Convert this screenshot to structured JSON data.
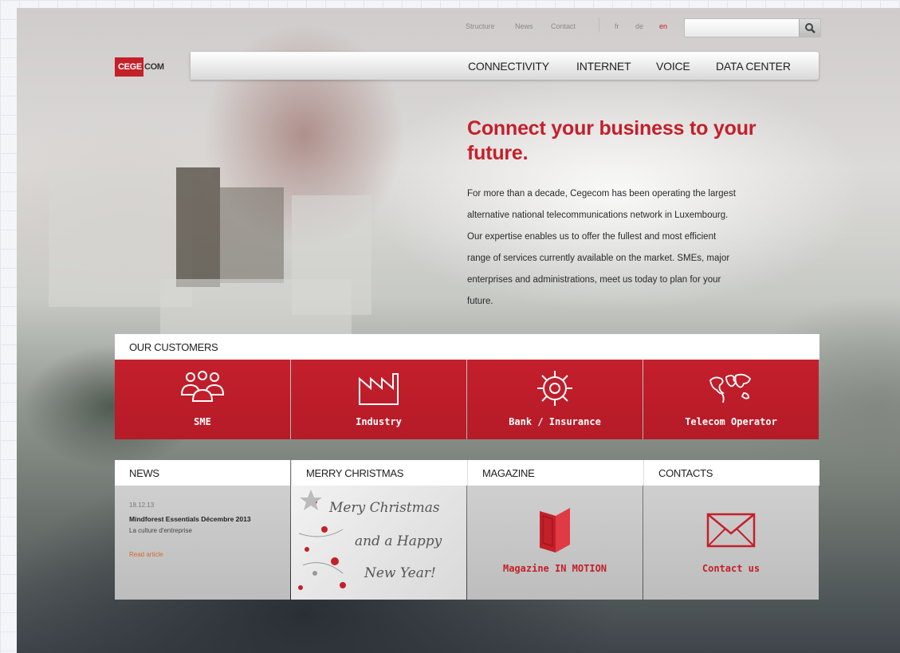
{
  "topbar": {
    "links": [
      "Structure",
      "News",
      "Contact"
    ],
    "languages": [
      "fr",
      "de",
      "en"
    ],
    "search_placeholder": ""
  },
  "logo": {
    "part1": "CEGE",
    "part2": "COM"
  },
  "nav": {
    "items": [
      "CONNECTIVITY",
      "INTERNET",
      "VOICE",
      "DATA CENTER"
    ]
  },
  "hero": {
    "title_line1": "Connect your business to your",
    "title_line2": "future.",
    "lines": [
      "For more than a decade, Cegecom has been operating the largest",
      "alternative national telecommunications network in Luxembourg.",
      "Our expertise enables us to offer the fullest and most efficient",
      "range of services currently available on the market. SMEs, major",
      "enterprises and administrations, meet us today to plan for your",
      "future."
    ]
  },
  "customers": {
    "header": "OUR CUSTOMERS",
    "tiles": [
      {
        "label": "SME",
        "icon": "people-icon"
      },
      {
        "label": "Industry",
        "icon": "factory-icon"
      },
      {
        "label": "Bank / Insurance",
        "icon": "helm-icon"
      },
      {
        "label": "Telecom Operator",
        "icon": "world-map-icon"
      }
    ]
  },
  "panels": {
    "news": {
      "header": "NEWS",
      "date": "18.12.13",
      "title": "Mindforest Essentials Décembre 2013",
      "subtitle": "La culture d'entreprise",
      "link": "Read article"
    },
    "christmas": {
      "header": "MERRY CHRISTMAS",
      "line1": "Mery Christmas",
      "line2": "and a Happy",
      "line3": "New Year!"
    },
    "magazine": {
      "header": "MAGAZINE",
      "link": "Magazine IN MOTION",
      "icon": "magazine-icon"
    },
    "contacts": {
      "header": "CONTACTS",
      "link": "Contact us",
      "icon": "envelope-icon"
    }
  },
  "colors": {
    "brand_red": "#c3202a",
    "panel_gray": "#c6c6c6",
    "link_orange": "#d46a2e"
  }
}
